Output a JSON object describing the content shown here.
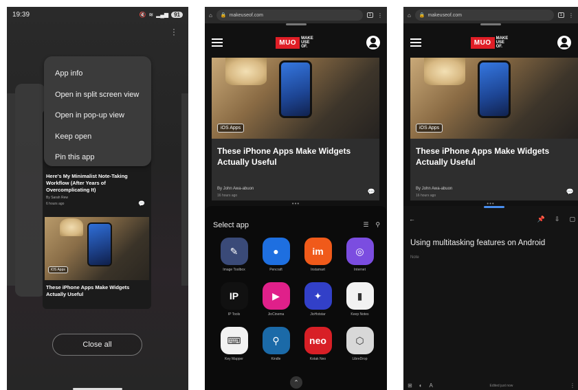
{
  "panel1": {
    "status": {
      "time": "19:39",
      "battery": "91"
    },
    "menu_items": [
      "App info",
      "Open in split screen view",
      "Open in pop-up view",
      "Keep open",
      "Pin this app"
    ],
    "article_top": {
      "title": "Here's My Minimalist Note-Taking Workflow (After Years of Overcomplicating It)",
      "byline": "By Sarah Rew",
      "time": "6 hours ago"
    },
    "article_bottom": {
      "tag": "iOS Apps",
      "title": "These iPhone Apps Make Widgets Actually Useful"
    },
    "close_all_label": "Close all"
  },
  "browser": {
    "url": "makeuseof.com",
    "tab_count": "1",
    "logo_mark": "MUO",
    "logo_text": [
      "MAKE",
      "USE",
      "OF."
    ],
    "article": {
      "tag": "iOS Apps",
      "title": "These iPhone Apps Make Widgets Actually Useful",
      "byline": "By John Awa-abuon",
      "time": "16 hours ago"
    }
  },
  "panel2": {
    "select_app_title": "Select app",
    "apps": [
      {
        "label": "Image Toolbox",
        "color": "#3a4a78",
        "glyph": "✎"
      },
      {
        "label": "Pencraft",
        "color": "#1e6fe0",
        "glyph": "●"
      },
      {
        "label": "Instamart",
        "color": "#f05a1a",
        "glyph": "im"
      },
      {
        "label": "Internet",
        "color": "#7b4de0",
        "glyph": "◎"
      },
      {
        "label": "IP Tools",
        "color": "#111111",
        "glyph": "IP"
      },
      {
        "label": "JioCinema",
        "color": "#e0208a",
        "glyph": "▶"
      },
      {
        "label": "JioHotstar",
        "color": "#3240c8",
        "glyph": "✦"
      },
      {
        "label": "Keep Notes",
        "color": "#f2f2f2",
        "glyph": "▮"
      },
      {
        "label": "Key Mapper",
        "color": "#f2f2f2",
        "glyph": "⌨"
      },
      {
        "label": "Kindle",
        "color": "#1b6aa8",
        "glyph": "⚲"
      },
      {
        "label": "Kotak Neo",
        "color": "#d81f26",
        "glyph": "neo"
      },
      {
        "label": "LibreDrop",
        "color": "#d8d8d8",
        "glyph": "⬡"
      }
    ]
  },
  "panel3": {
    "note_title": "Using multitasking features on Android",
    "note_placeholder": "Note",
    "edited_text": "Edited just now"
  }
}
